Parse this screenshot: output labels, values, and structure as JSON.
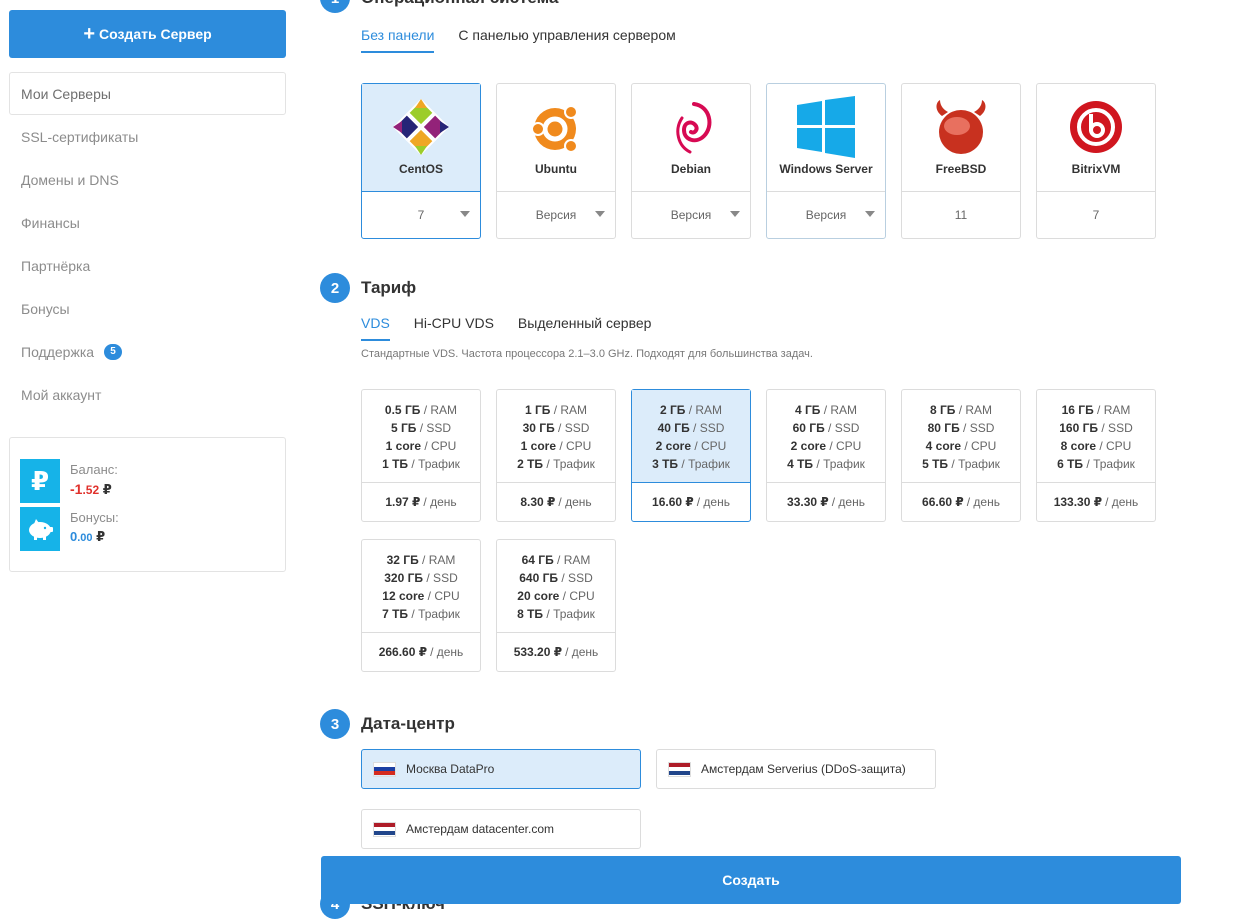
{
  "sidebar": {
    "create_label": "Создать Сервер",
    "items": [
      {
        "label": "Мои Серверы",
        "active": true
      },
      {
        "label": "SSL-сертификаты"
      },
      {
        "label": "Домены и DNS"
      },
      {
        "label": "Финансы"
      },
      {
        "label": "Партнёрка"
      },
      {
        "label": "Бонусы"
      },
      {
        "label": "Поддержка",
        "badge": "5"
      },
      {
        "label": "Мой аккаунт"
      }
    ],
    "balance": {
      "label": "Баланс:",
      "int": "-1",
      "frac": ".52",
      "currency": "₽",
      "icon": "ruble-icon"
    },
    "bonuses": {
      "label": "Бонусы:",
      "int": "0",
      "frac": ".00",
      "currency": "₽",
      "icon": "piggy-bank-icon"
    }
  },
  "steps": {
    "os": {
      "num": "1",
      "title": "Операционная система"
    },
    "tariff": {
      "num": "2",
      "title": "Тариф"
    },
    "dc": {
      "num": "3",
      "title": "Дата-центр"
    },
    "ssh": {
      "num": "4",
      "title": "SSH-ключ"
    }
  },
  "os_tabs": [
    {
      "label": "Без панели",
      "active": true
    },
    {
      "label": "С панелью управления сервером"
    }
  ],
  "os_cards": [
    {
      "name": "CentOS",
      "version": "7",
      "dropdown": true,
      "selected": true,
      "icon": "centos-logo-icon"
    },
    {
      "name": "Ubuntu",
      "version": "Версия",
      "dropdown": true,
      "icon": "ubuntu-logo-icon"
    },
    {
      "name": "Debian",
      "version": "Версия",
      "dropdown": true,
      "icon": "debian-logo-icon"
    },
    {
      "name": "Windows Server",
      "version": "Версия",
      "dropdown": true,
      "icon": "windows-logo-icon"
    },
    {
      "name": "FreeBSD",
      "version": "11",
      "dropdown": false,
      "icon": "freebsd-logo-icon"
    },
    {
      "name": "BitrixVM",
      "version": "7",
      "dropdown": false,
      "icon": "bitrix-logo-icon"
    }
  ],
  "tariff_tabs": [
    {
      "label": "VDS",
      "active": true
    },
    {
      "label": "Hi-CPU VDS"
    },
    {
      "label": "Выделенный сервер"
    }
  ],
  "tariff_desc": "Стандартные VDS. Частота процессора 2.1–3.0 GHz. Подходят для большинства задач.",
  "units": {
    "ram": "/ RAM",
    "ssd": "/ SSD",
    "cpu": "/ CPU",
    "traffic": "/ Трафик",
    "per_day": "/ день"
  },
  "plans": [
    {
      "ram": "0.5 ГБ",
      "ssd": "5 ГБ",
      "cpu": "1 core",
      "traffic": "1 ТБ",
      "price": "1.97 ₽"
    },
    {
      "ram": "1 ГБ",
      "ssd": "30 ГБ",
      "cpu": "1 core",
      "traffic": "2 ТБ",
      "price": "8.30 ₽"
    },
    {
      "ram": "2 ГБ",
      "ssd": "40 ГБ",
      "cpu": "2 core",
      "traffic": "3 ТБ",
      "price": "16.60 ₽",
      "selected": true
    },
    {
      "ram": "4 ГБ",
      "ssd": "60 ГБ",
      "cpu": "2 core",
      "traffic": "4 ТБ",
      "price": "33.30 ₽"
    },
    {
      "ram": "8 ГБ",
      "ssd": "80 ГБ",
      "cpu": "4 core",
      "traffic": "5 ТБ",
      "price": "66.60 ₽"
    },
    {
      "ram": "16 ГБ",
      "ssd": "160 ГБ",
      "cpu": "8 core",
      "traffic": "6 ТБ",
      "price": "133.30 ₽"
    },
    {
      "ram": "32 ГБ",
      "ssd": "320 ГБ",
      "cpu": "12 core",
      "traffic": "7 ТБ",
      "price": "266.60 ₽"
    },
    {
      "ram": "64 ГБ",
      "ssd": "640 ГБ",
      "cpu": "20 core",
      "traffic": "8 ТБ",
      "price": "533.20 ₽"
    }
  ],
  "datacenters": [
    {
      "label": "Москва DataPro",
      "flag": "russia-flag-icon",
      "selected": true
    },
    {
      "label": "Амстердам Serverius (DDoS-защита)",
      "flag": "netherlands-flag-icon"
    },
    {
      "label": "Амстердам datacenter.com",
      "flag": "netherlands-flag-icon"
    }
  ],
  "submit_label": "Создать",
  "colors": {
    "accent": "#2d8cdc",
    "selected_bg": "#dcecfa",
    "negative": "#e0312c",
    "balance_icon": "#16b3e8"
  }
}
